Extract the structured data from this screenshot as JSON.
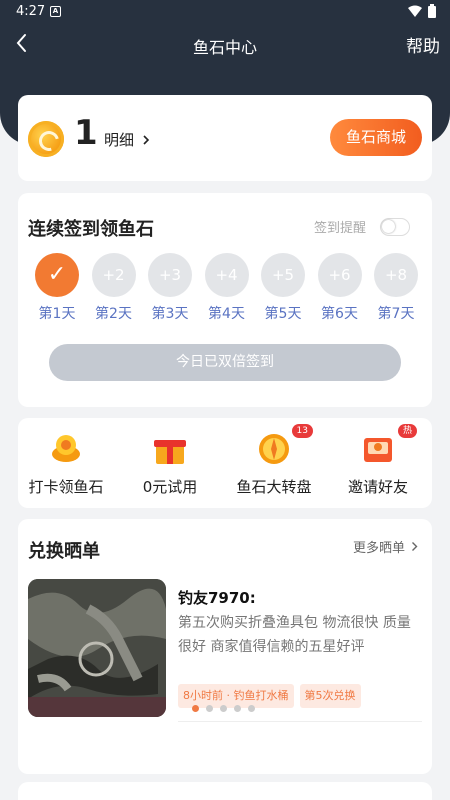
{
  "status": {
    "time": "4:27",
    "notif": "A"
  },
  "nav": {
    "title": "鱼石中心",
    "help": "帮助"
  },
  "balance": {
    "amount": "1",
    "detail_label": "明细",
    "mall_button": "鱼石商城"
  },
  "signin": {
    "title": "连续签到领鱼石",
    "reminder_label": "签到提醒",
    "reminder_on": false,
    "days": [
      {
        "reward": "✓",
        "label": "第1天",
        "done": true
      },
      {
        "reward": "+2",
        "label": "第2天",
        "done": false
      },
      {
        "reward": "+3",
        "label": "第3天",
        "done": false
      },
      {
        "reward": "+4",
        "label": "第4天",
        "done": false
      },
      {
        "reward": "+5",
        "label": "第5天",
        "done": false
      },
      {
        "reward": "+6",
        "label": "第6天",
        "done": false
      },
      {
        "reward": "+8",
        "label": "第7天",
        "done": false
      }
    ],
    "double_button": "今日已双倍签到"
  },
  "entries": [
    {
      "label": "打卡领鱼石",
      "icon": "fish-stone-icon",
      "badge": ""
    },
    {
      "label": "0元试用",
      "icon": "gift-icon",
      "badge": ""
    },
    {
      "label": "鱼石大转盘",
      "icon": "wheel-icon",
      "badge": "13"
    },
    {
      "label": "邀请好友",
      "icon": "invite-icon",
      "badge": "热"
    }
  ],
  "showcase": {
    "title": "兑换晒单",
    "more": "更多晒单",
    "user": "钓友7970:",
    "review": "第五次购买折叠渔具包 物流很快 质量很好 商家值得信赖的五星好评",
    "tag_time": "8小时前 · 钓鱼打水桶",
    "tag_count": "第5次兑换",
    "dots": 5,
    "active_dot": 0
  },
  "colors": {
    "accent": "#f27a32",
    "header": "#27313f",
    "day_label": "#5a73c2"
  }
}
